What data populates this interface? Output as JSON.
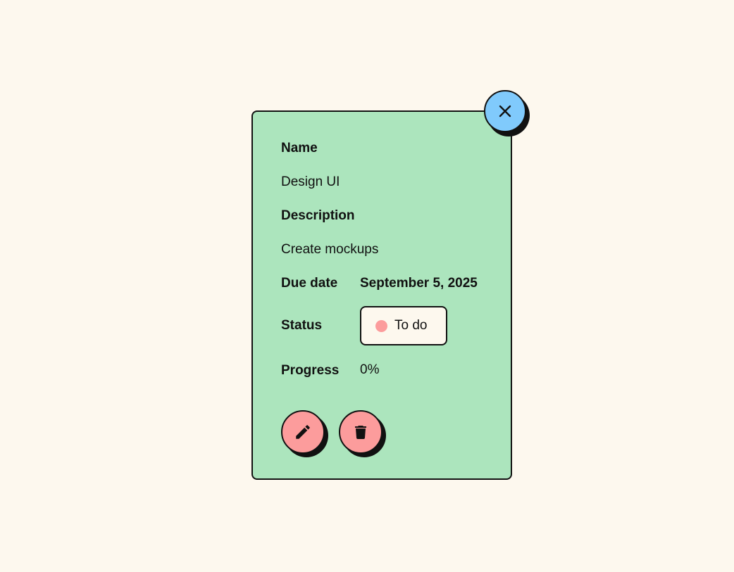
{
  "task": {
    "name_label": "Name",
    "name_value": "Design UI",
    "description_label": "Description",
    "description_value": "Create mockups",
    "due_label": "Due date",
    "due_value": "September 5, 2025",
    "status_label": "Status",
    "status_value": "To do",
    "progress_label": "Progress",
    "progress_value": "0%"
  },
  "icons": {
    "close": "close-icon",
    "edit": "pencil-icon",
    "delete": "trash-icon"
  },
  "colors": {
    "page_background": "#fdf8ee",
    "card_background": "#ace5bd",
    "close_button": "#80cafc",
    "action_buttons": "#fc9c9c",
    "status_dot": "#fc9c9c"
  }
}
